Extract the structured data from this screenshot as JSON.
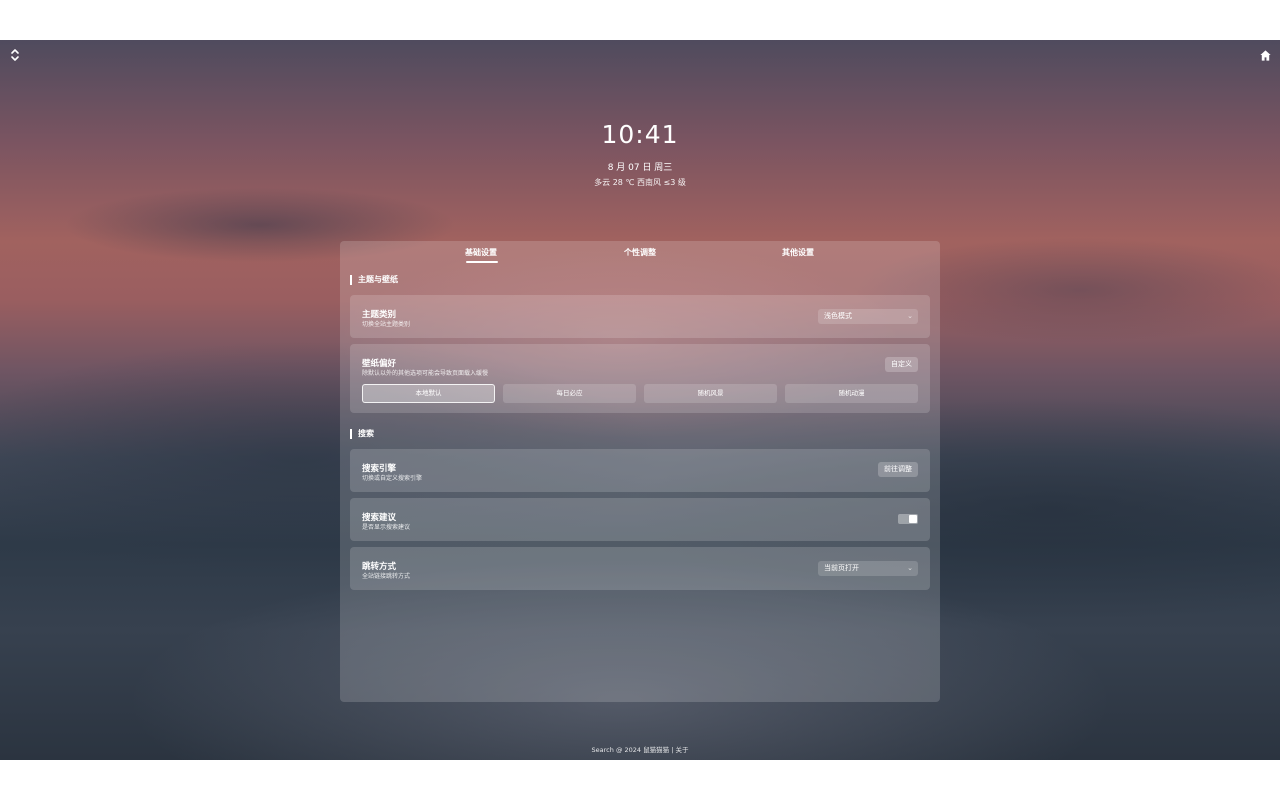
{
  "clock": "10:41",
  "date": "8 月 07 日 周三",
  "weather": "多云 28 ℃ 西南风 ≤3 级",
  "tabs": [
    {
      "label": "基础设置",
      "active": true
    },
    {
      "label": "个性调整",
      "active": false
    },
    {
      "label": "其他设置",
      "active": false
    }
  ],
  "sections": {
    "theme": {
      "title": "主题与壁纸",
      "theme_type": {
        "title": "主题类别",
        "desc": "切换全站主题类别",
        "value": "浅色模式"
      },
      "wallpaper": {
        "title": "壁纸偏好",
        "desc": "除默认以外的其他选项可能会导致页面载入缓慢",
        "custom_label": "自定义",
        "options": [
          "本地默认",
          "每日必应",
          "随机风景",
          "随机动漫"
        ],
        "active_option": "本地默认"
      }
    },
    "search": {
      "title": "搜索",
      "engine": {
        "title": "搜索引擎",
        "desc": "切换或自定义搜索引擎",
        "button": "前往调整"
      },
      "suggest": {
        "title": "搜索建议",
        "desc": "是否显示搜索建议",
        "enabled": true
      },
      "jump": {
        "title": "跳转方式",
        "desc": "全站链接跳转方式",
        "value": "当前页打开"
      }
    }
  },
  "footer": {
    "copyright": "Search @ 2024 ",
    "author": "鼠猫猫猫",
    "separator": " | ",
    "about": "关于"
  },
  "icons": {
    "left": "expand-collapse-icon",
    "right": "home-icon"
  }
}
